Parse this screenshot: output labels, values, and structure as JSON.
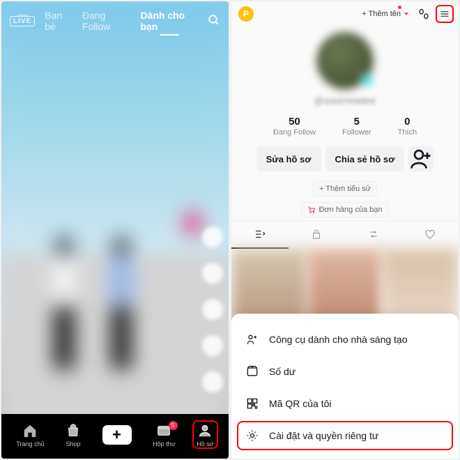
{
  "left": {
    "tabs": [
      "Bạn bè",
      "Đang Follow",
      "Dành cho bạn"
    ],
    "nav": {
      "home": "Trang chủ",
      "shop": "Shop",
      "inbox": "Hộp thư",
      "profile": "Hồ sơ",
      "badge": "5"
    }
  },
  "right": {
    "addName": "+ Thêm tên",
    "username": "@username",
    "stats": {
      "following": {
        "n": "50",
        "l": "Đang Follow"
      },
      "follower": {
        "n": "5",
        "l": "Follower"
      },
      "like": {
        "n": "0",
        "l": "Thích"
      }
    },
    "editBtn": "Sửa hồ sơ",
    "shareBtn": "Chia sẻ hồ sơ",
    "addBio": "+ Thêm tiểu sử",
    "orders": "Đơn hàng của bạn",
    "menu": {
      "creator": "Công cụ dành cho nhà sáng tạo",
      "balance": "Số dư",
      "qr": "Mã QR của tôi",
      "settings": "Cài đặt và quyền riêng tư"
    }
  }
}
